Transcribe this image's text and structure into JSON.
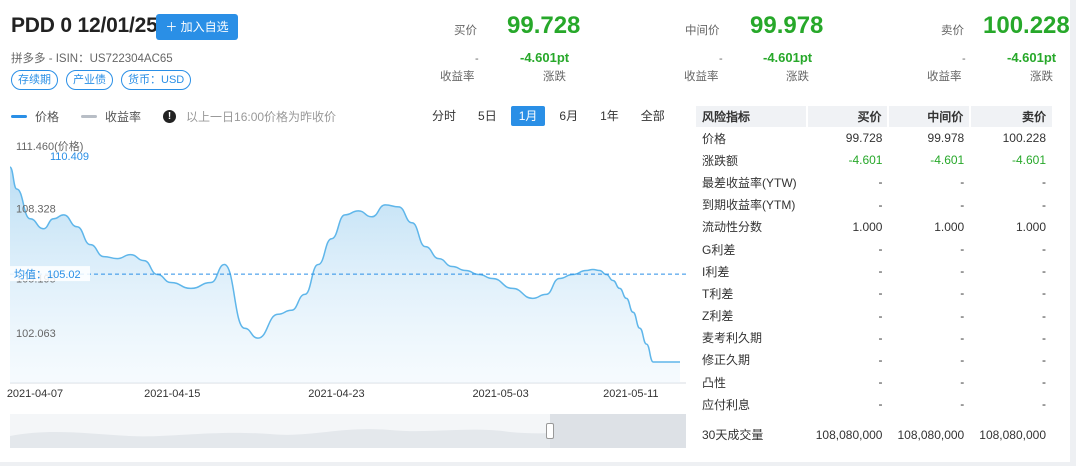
{
  "header": {
    "title": "PDD 0 12/01/25",
    "add_button": "加入自选",
    "subtitle": "拼多多 - ISIN：US722304AC65",
    "tags": [
      "存续期",
      "产业债",
      "货币：USD"
    ]
  },
  "quotes": [
    {
      "label": "买价",
      "price": "99.728",
      "dash": "-",
      "change": "-4.601pt",
      "sub1": "收益率",
      "sub2": "涨跌"
    },
    {
      "label": "中间价",
      "price": "99.978",
      "dash": "-",
      "change": "-4.601pt",
      "sub1": "收益率",
      "sub2": "涨跌"
    },
    {
      "label": "卖价",
      "price": "100.228",
      "dash": "-",
      "change": "-4.601pt",
      "sub1": "收益率",
      "sub2": "涨跌"
    }
  ],
  "legend": {
    "price": "价格",
    "yield": "收益率",
    "note": "以上一日16:00价格为昨收价"
  },
  "ranges": [
    "分时",
    "5日",
    "1月",
    "6月",
    "1年",
    "全部"
  ],
  "active_range": "1月",
  "colors": {
    "accent": "#2a8fe6",
    "down": "#27a82a",
    "line": "#5fb6ea",
    "fill": "#cfe8f8"
  },
  "chart_data": {
    "type": "area",
    "y_ticks": [
      "111.460(价格)",
      "108.328",
      "105.195",
      "102.063"
    ],
    "max_label": "110.409",
    "avg_label": "均值：105.02",
    "avg": 105.02,
    "ylim": [
      100.5,
      111.46
    ],
    "x_ticks": [
      {
        "label": "2021-04-07",
        "t": 0.04
      },
      {
        "label": "2021-04-15",
        "t": 0.245
      },
      {
        "label": "2021-04-23",
        "t": 0.49
      },
      {
        "label": "2021-05-03",
        "t": 0.735
      },
      {
        "label": "2021-05-11",
        "t": 0.93
      }
    ],
    "x": [
      0,
      0.01,
      0.03,
      0.05,
      0.065,
      0.08,
      0.1,
      0.12,
      0.14,
      0.16,
      0.18,
      0.2,
      0.22,
      0.24,
      0.27,
      0.3,
      0.32,
      0.35,
      0.37,
      0.4,
      0.42,
      0.44,
      0.46,
      0.48,
      0.5,
      0.52,
      0.54,
      0.56,
      0.58,
      0.6,
      0.62,
      0.64,
      0.66,
      0.68,
      0.7,
      0.72,
      0.75,
      0.78,
      0.8,
      0.82,
      0.84,
      0.86,
      0.87,
      0.88,
      0.89,
      0.9,
      0.91,
      0.92,
      0.93,
      0.94,
      0.95,
      0.96,
      0.97,
      0.98,
      0.99,
      1.0
    ],
    "values": [
      110.4,
      109.3,
      107.8,
      107.3,
      107.8,
      108.0,
      107.4,
      106.5,
      105.9,
      105.8,
      106.0,
      105.7,
      105.0,
      104.6,
      104.3,
      104.6,
      105.5,
      102.3,
      101.8,
      103.0,
      103.2,
      104.0,
      105.5,
      106.8,
      108.0,
      108.2,
      107.9,
      108.5,
      108.4,
      107.6,
      106.4,
      105.8,
      105.4,
      105.2,
      105.0,
      104.8,
      104.3,
      103.8,
      104.0,
      104.8,
      105.0,
      105.2,
      105.25,
      105.2,
      105.0,
      104.7,
      104.3,
      103.8,
      103.1,
      102.3,
      101.5,
      100.6,
      100.6,
      100.6,
      100.6,
      100.6
    ]
  },
  "table": {
    "headers": [
      "风险指标",
      "买价",
      "中间价",
      "卖价"
    ],
    "rows": [
      {
        "name": "价格",
        "bid": "99.728",
        "mid": "99.978",
        "ask": "100.228",
        "green": false
      },
      {
        "name": "涨跌额",
        "bid": "-4.601",
        "mid": "-4.601",
        "ask": "-4.601",
        "green": true
      },
      {
        "name": "最差收益率(YTW)",
        "bid": "-",
        "mid": "-",
        "ask": "-",
        "green": false
      },
      {
        "name": "到期收益率(YTM)",
        "bid": "-",
        "mid": "-",
        "ask": "-",
        "green": false
      },
      {
        "name": "流动性分数",
        "bid": "1.000",
        "mid": "1.000",
        "ask": "1.000",
        "green": false
      },
      {
        "name": "G利差",
        "bid": "-",
        "mid": "-",
        "ask": "-",
        "green": false
      },
      {
        "name": "I利差",
        "bid": "-",
        "mid": "-",
        "ask": "-",
        "green": false
      },
      {
        "name": "T利差",
        "bid": "-",
        "mid": "-",
        "ask": "-",
        "green": false
      },
      {
        "name": "Z利差",
        "bid": "-",
        "mid": "-",
        "ask": "-",
        "green": false
      },
      {
        "name": "麦考利久期",
        "bid": "-",
        "mid": "-",
        "ask": "-",
        "green": false
      },
      {
        "name": "修正久期",
        "bid": "-",
        "mid": "-",
        "ask": "-",
        "green": false
      },
      {
        "name": "凸性",
        "bid": "-",
        "mid": "-",
        "ask": "-",
        "green": false
      },
      {
        "name": "应付利息",
        "bid": "-",
        "mid": "-",
        "ask": "-",
        "green": false
      }
    ],
    "volume": {
      "name": "30天成交量",
      "bid": "108,080,000",
      "mid": "108,080,000",
      "ask": "108,080,000"
    }
  }
}
